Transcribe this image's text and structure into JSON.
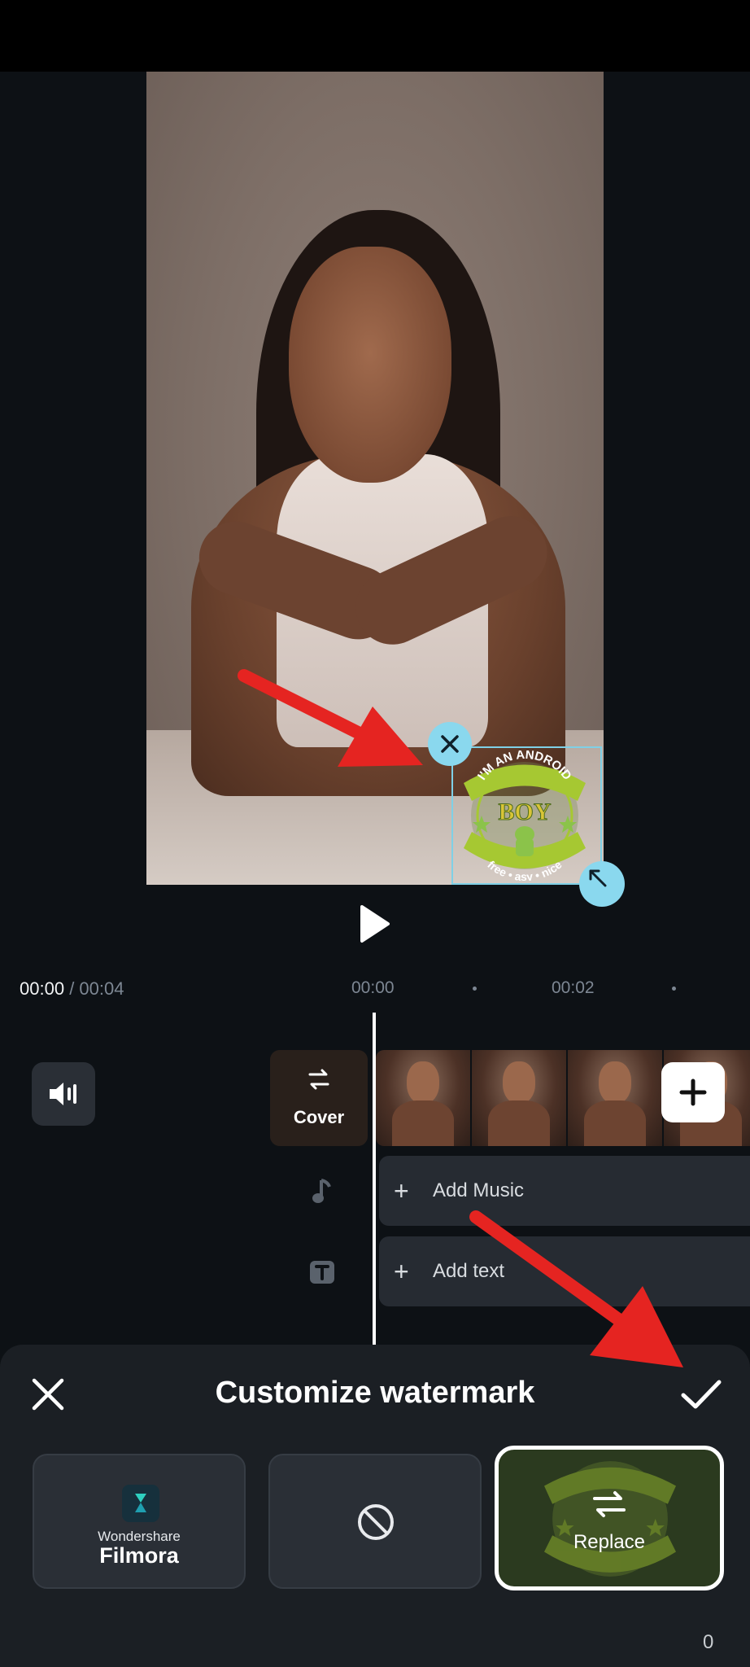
{
  "timeline": {
    "current_time": "00:00",
    "total_time": "00:04",
    "ruler_marks": [
      "00:00",
      "00:02"
    ],
    "cover_label": "Cover",
    "add_music_label": "Add Music",
    "add_text_label": "Add text"
  },
  "panel": {
    "title": "Customize watermark",
    "options": {
      "filmora_brand_small": "Wondershare",
      "filmora_brand_big": "Filmora",
      "replace_label": "Replace"
    },
    "counter": "0"
  },
  "watermark": {
    "top_text": "I'M AN ANDROID",
    "center_text": "BOY",
    "bottom_text": "free • asy • nice"
  },
  "colors": {
    "accent_handle": "#8ad8ee",
    "annotation_arrow": "#e52421",
    "watermark_green": "#a6c832"
  }
}
